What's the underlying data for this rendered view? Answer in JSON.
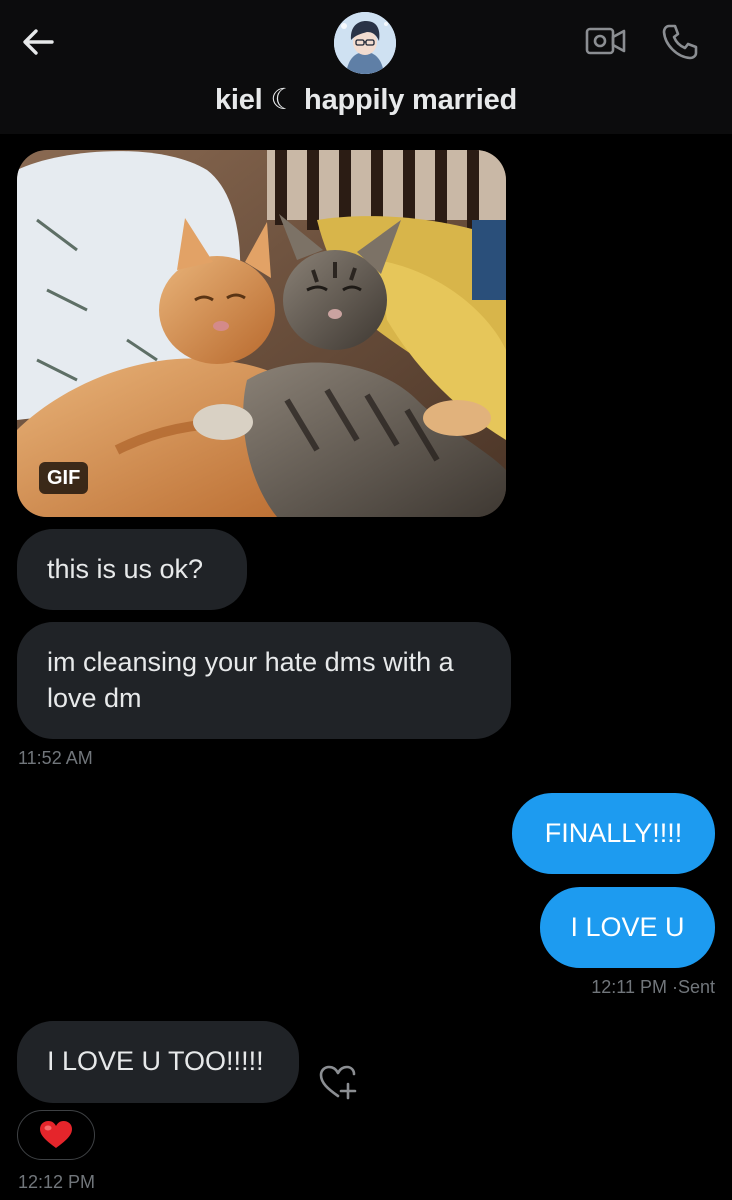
{
  "header": {
    "title": "kiel ☾ happily married",
    "back_icon": "arrow-left-icon",
    "video_icon": "video-camera-icon",
    "phone_icon": "phone-icon"
  },
  "messages": [
    {
      "type": "gif",
      "direction": "incoming",
      "badge": "GIF"
    },
    {
      "type": "text",
      "direction": "incoming",
      "text": "this is us ok?"
    },
    {
      "type": "text",
      "direction": "incoming",
      "text": "im cleansing your hate dms with a love dm"
    },
    {
      "type": "text",
      "direction": "outgoing",
      "text": "FINALLY!!!!"
    },
    {
      "type": "text",
      "direction": "outgoing",
      "text": "I LOVE U"
    },
    {
      "type": "text",
      "direction": "incoming",
      "text": "I LOVE U TOO!!!!!",
      "reaction": "❤️"
    }
  ],
  "timestamps": {
    "first": "11:52 AM",
    "second": "12:11 PM ·Sent",
    "third": "12:12 PM"
  },
  "colors": {
    "background": "#000000",
    "header_bg": "#0c0c0d",
    "incoming_bubble": "#202327",
    "outgoing_bubble": "#1d9bf0",
    "muted_text": "#71767b"
  },
  "add_reaction_icon": "heart-plus-icon"
}
